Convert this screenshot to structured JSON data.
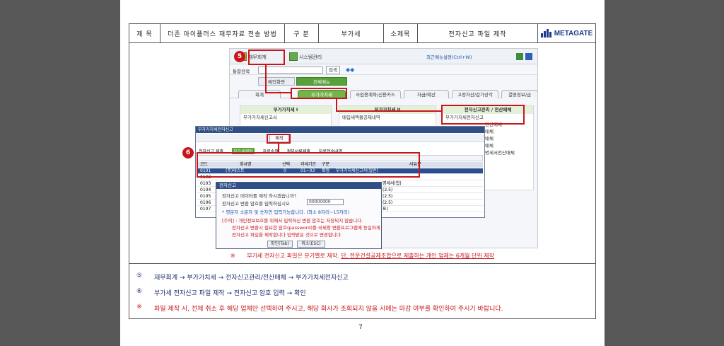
{
  "header": {
    "title_label": "제  목",
    "title_value": "더존 아이플러스 재무자료 전송 방법",
    "category_label": "구  분",
    "category_value": "부가세",
    "subtitle_label": "소제목",
    "subtitle_value": "전자신고 파일 제작",
    "logo_text": "METAGATE"
  },
  "screenshot": {
    "menu_main": "재무회계",
    "menu_system": "시스템관리",
    "search_label": "통합검색",
    "search_button": "검색",
    "favorites_btn": "최근메뉴설정(Ctrl+W)",
    "tabs": [
      "메인화면",
      "전체메뉴"
    ],
    "subtabs": [
      "회계",
      "부가가치세",
      "사업용계좌/신용카드",
      "자금/예산",
      "고정자산/감가상각",
      "결영정보/급"
    ],
    "col1_title": "부가가치세 I",
    "col1_items": [
      "부가가치세신고서"
    ],
    "col2_title": "부가가치세 II",
    "col2_items": [
      "매입세액불공제내역"
    ],
    "col3_title": "전자신고관리 / 전산매체",
    "col3_items": [
      "부가가치세전자신고",
      "전산매체",
      "매체",
      "매체",
      "매체",
      "명세서전산매체"
    ],
    "dialog_title": "부가가치세전자신고",
    "dialog_make_btn": "제작",
    "dialog_tabs": [
      "전자신고 제출",
      "부가세제작",
      "자료수정",
      "첨부서류제출",
      "자료전송내역"
    ],
    "grid_head": [
      "코드",
      "회사명",
      "선택",
      "과세기간",
      "구분",
      "사유분"
    ],
    "grid_rows": [
      [
        "0101",
        "(주)테스트",
        "0",
        "01~03",
        "확정",
        "부가가치세신고서(일반)"
      ],
      [
        "0102",
        "",
        "",
        "",
        "",
        ""
      ],
      [
        "0103",
        "",
        "",
        "",
        "",
        "명세서(합)"
      ],
      [
        "0104",
        "",
        "",
        "",
        "",
        "(2.5)"
      ],
      [
        "0105",
        "",
        "",
        "",
        "",
        "(2.5)"
      ],
      [
        "0106",
        "",
        "",
        "",
        "",
        "(2.5)"
      ],
      [
        "0107",
        "",
        "",
        "",
        "",
        "표)"
      ]
    ],
    "msg_title": "전자신고",
    "msg_line1": "전자신고 데이터를 제작 하시겠습니까?",
    "msg_line2_label": "전자신고 변환 암호를 입력하십시오",
    "msg_line2_value": "00000000",
    "msg_line3": "* 영문자 소문자 및 숫자만 입력가능합니다. (최소 8자리~15자리)",
    "msg_line4": "[주의] : 개인정보보호를 위해서 입력하신 변환 암호는 저장되지 않습니다.",
    "msg_line5": "전자신고 변환시 필요한 암호(password)를 국세청 변환프로그램에 동일하게",
    "msg_line6": "전자신고 파일을 제작합니다 입력받은 것으로 변경합니다.",
    "msg_ok": "확인(Tab)",
    "msg_cancel": "취소(ESC)"
  },
  "badges": {
    "step5": "5",
    "step6": "6"
  },
  "note": {
    "mark": "※",
    "text_plain": "부가세 전자신고 파일은 분기별로 제작. ",
    "text_underlined": "단, 전문건설공제조합으로 제출하는 개인 업체는 6개월 단위 제작"
  },
  "steps": [
    {
      "mark": "⑤",
      "text": "재무회계 → 부가가치세 → 전자신고관리/전산매체 → 부가가치세전자신고"
    },
    {
      "mark": "⑥",
      "text": "부가세 전자신고 파일 제작 → 전자신고 암호 입력 → 확인"
    },
    {
      "mark": "※",
      "text": "파일 제작 시, 전체 취소 후 해당 업체만 선택하여 주시고, 해당 회사가 조회되지 않을 시에는 마감 여부를 확인하여 주시기 바랍니다."
    }
  ],
  "page_number": "7",
  "colors": {
    "accent_red": "#c7161b",
    "navy": "#2e3a7c",
    "green": "#56a13a"
  }
}
